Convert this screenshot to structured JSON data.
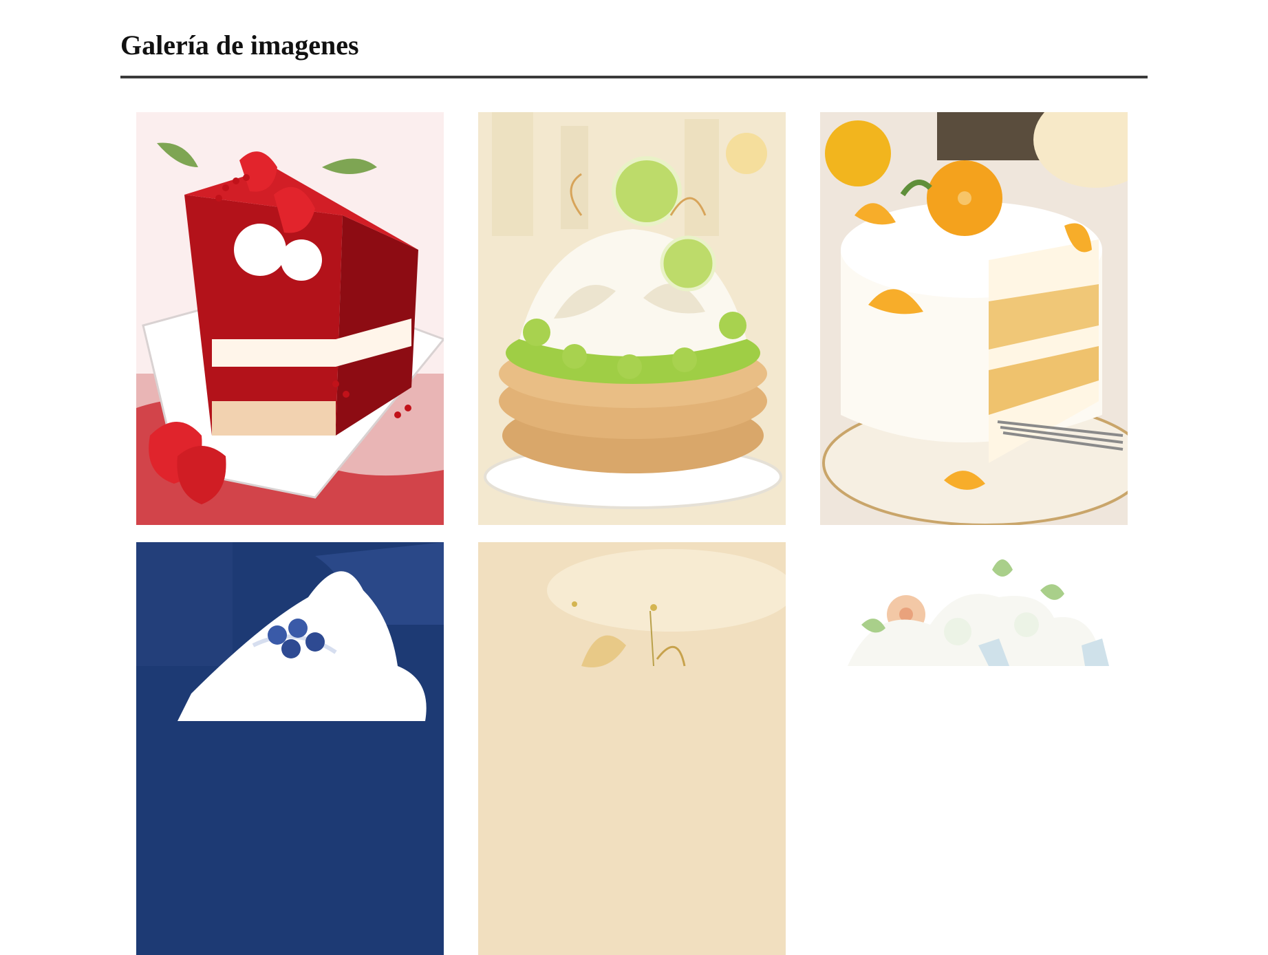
{
  "page": {
    "title": "Galería de imagenes"
  },
  "gallery": {
    "images": [
      {
        "subject": "strawberry cake slice",
        "palette": [
          "#c8141c",
          "#f6e0e0",
          "#ffffff"
        ]
      },
      {
        "subject": "lime meringue pie",
        "palette": [
          "#f1e3c3",
          "#9fce45",
          "#d39d5e"
        ]
      },
      {
        "subject": "orange layer cake",
        "palette": [
          "#f4a21d",
          "#fff2d6",
          "#7a6a52"
        ]
      },
      {
        "subject": "blueberry cream dessert",
        "palette": [
          "#1d3a74",
          "#ffffff",
          "#3a5aa8"
        ]
      },
      {
        "subject": "golden meringue dessert",
        "palette": [
          "#f1dfbf",
          "#e8c987",
          "#ffffff"
        ]
      },
      {
        "subject": "floral cream cake",
        "palette": [
          "#ffffff",
          "#a9cf8a",
          "#f3c8a6"
        ]
      }
    ]
  }
}
